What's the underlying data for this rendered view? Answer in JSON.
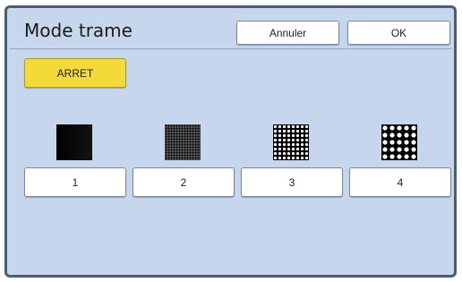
{
  "dialog": {
    "title": "Mode trame",
    "cancel_label": "Annuler",
    "ok_label": "OK",
    "off_label": "ARRET",
    "modes": [
      {
        "label": "1"
      },
      {
        "label": "2"
      },
      {
        "label": "3"
      },
      {
        "label": "4"
      }
    ]
  },
  "colors": {
    "panel_bg": "#c6d7ed",
    "off_button_bg": "#f3da3a",
    "frame_border": "#4e5d6e"
  }
}
